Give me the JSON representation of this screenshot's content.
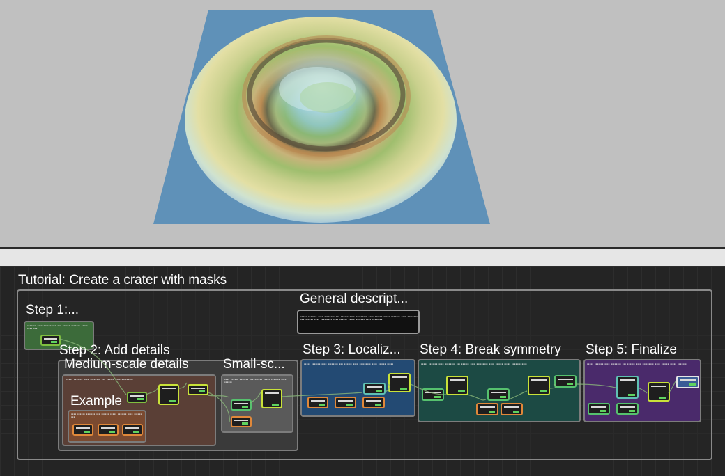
{
  "graph_title": "Tutorial: Create a crater with masks",
  "frames": {
    "step1": "Step 1:...",
    "general": "General descript...",
    "step2": "Step 2: Add details",
    "medium": "Medium-scale details",
    "small": "Small-sc...",
    "example": "Example",
    "step3": "Step 3: Localiz...",
    "step4": "Step 4: Break symmetry",
    "step5": "Step 5: Finalize"
  },
  "colors": {
    "viewport_bg": "#c0c0c0",
    "graph_bg": "#242424",
    "step1_fill": "#3c6b3a",
    "step2_fill": "#3a3a3a",
    "medium_fill": "#5a3f36",
    "example_fill": "#7b4a30",
    "step3_fill": "#234a73",
    "step4_fill": "#1c4a44",
    "step5_fill": "#4a2a6b"
  },
  "icons": {
    "terrain": "crater-terrain-render"
  }
}
